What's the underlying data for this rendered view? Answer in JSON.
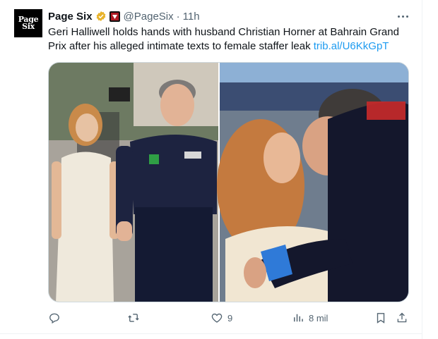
{
  "tweet": {
    "avatar_text": [
      "Page",
      "Six"
    ],
    "display_name": "Page Six",
    "handle": "@PageSix",
    "separator": "·",
    "time": "11h",
    "text": "Geri Halliwell holds hands with husband Christian Horner at Bahrain Grand Prix after his alleged intimate texts to female staffer leak",
    "link": "trib.al/U6KkGpT",
    "images": [
      {
        "name": "walking-together-photo"
      },
      {
        "name": "kiss-photo"
      }
    ]
  },
  "actions": {
    "reply_count": "",
    "repost_count": "",
    "like_count": "9",
    "views_count": "8 mil"
  },
  "colors": {
    "accent": "#1d9bf0",
    "muted": "#536471",
    "verified_gold": "#e8b32a"
  }
}
